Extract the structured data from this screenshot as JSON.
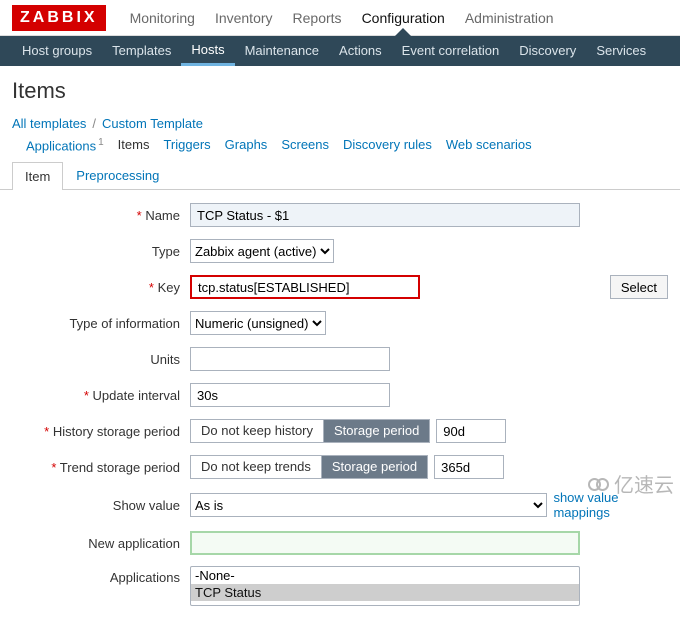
{
  "brand": "ZABBIX",
  "topnav": {
    "items": [
      {
        "label": "Monitoring"
      },
      {
        "label": "Inventory"
      },
      {
        "label": "Reports"
      },
      {
        "label": "Configuration",
        "active": true
      },
      {
        "label": "Administration"
      }
    ]
  },
  "subnav": {
    "items": [
      {
        "label": "Host groups"
      },
      {
        "label": "Templates"
      },
      {
        "label": "Hosts",
        "active": true
      },
      {
        "label": "Maintenance"
      },
      {
        "label": "Actions"
      },
      {
        "label": "Event correlation"
      },
      {
        "label": "Discovery"
      },
      {
        "label": "Services"
      }
    ]
  },
  "page_title": "Items",
  "breadcrumb": {
    "all_templates": "All templates",
    "template_name": "Custom Template"
  },
  "hosttabs": {
    "applications": {
      "label": "Applications",
      "count": "1"
    },
    "items": {
      "label": "Items",
      "selected": true
    },
    "triggers": {
      "label": "Triggers"
    },
    "graphs": {
      "label": "Graphs"
    },
    "screens": {
      "label": "Screens"
    },
    "discovery": {
      "label": "Discovery rules"
    },
    "web": {
      "label": "Web scenarios"
    }
  },
  "formtabs": {
    "item": "Item",
    "preprocessing": "Preprocessing"
  },
  "form": {
    "name": {
      "label": "Name",
      "value": "TCP Status - $1"
    },
    "type": {
      "label": "Type",
      "value": "Zabbix agent (active)"
    },
    "key": {
      "label": "Key",
      "value": "tcp.status[ESTABLISHED]",
      "select_btn": "Select"
    },
    "typeinfo": {
      "label": "Type of information",
      "value": "Numeric (unsigned)"
    },
    "units": {
      "label": "Units",
      "value": ""
    },
    "update_interval": {
      "label": "Update interval",
      "value": "30s"
    },
    "history": {
      "label": "History storage period",
      "opt_no": "Do not keep history",
      "opt_yes": "Storage period",
      "value": "90d"
    },
    "trend": {
      "label": "Trend storage period",
      "opt_no": "Do not keep trends",
      "opt_yes": "Storage period",
      "value": "365d"
    },
    "showvalue": {
      "label": "Show value",
      "value": "As is",
      "mappings_link": "show value mappings"
    },
    "newapp": {
      "label": "New application",
      "value": ""
    },
    "applications": {
      "label": "Applications",
      "options": [
        "-None-",
        "TCP Status"
      ],
      "selected": "TCP Status"
    }
  },
  "watermark": "亿速云"
}
